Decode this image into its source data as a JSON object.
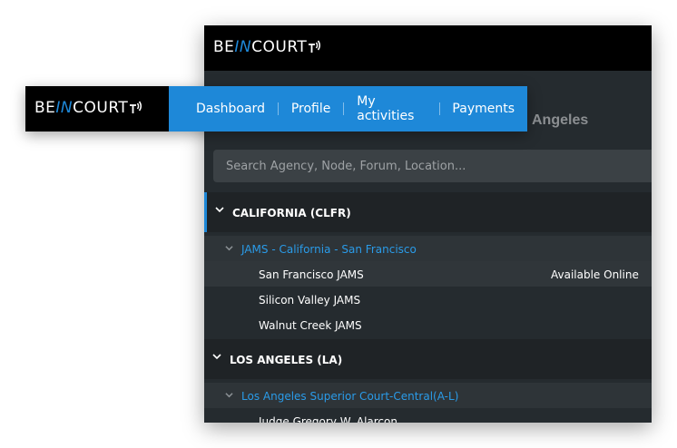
{
  "brand": {
    "prefix": "BE",
    "highlight": "IN",
    "suffix": "COURT",
    "accent": "#1e88d8"
  },
  "nav": {
    "items": [
      {
        "label": "Dashboard"
      },
      {
        "label": "Profile"
      },
      {
        "label": "My activities"
      },
      {
        "label": "Payments"
      }
    ]
  },
  "panel": {
    "subheading": "Angeles",
    "search": {
      "placeholder": "Search Agency, Node, Forum, Location..."
    },
    "groups": [
      {
        "label": "CALIFORNIA (CLFR)",
        "subgroup": "JAMS - California - San Francisco",
        "items": [
          {
            "label": "San Francisco JAMS",
            "status": "Available Online"
          },
          {
            "label": "Silicon Valley JAMS"
          },
          {
            "label": "Walnut Creek JAMS"
          }
        ]
      },
      {
        "label": "LOS ANGELES (LA)",
        "subgroup": "Los Angeles Superior Court-Central(A-L)",
        "items": [
          {
            "label": "Judge Gregory W. Alarcon"
          }
        ]
      }
    ]
  }
}
